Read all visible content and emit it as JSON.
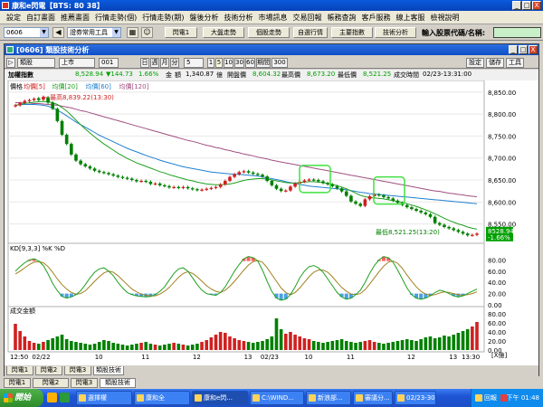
{
  "window": {
    "title": "康和e閃電【BTS: 80 38】",
    "buttons": [
      "_",
      "□",
      "X"
    ]
  },
  "menubar": [
    "設定",
    "自訂畫面",
    "推薦畫面",
    "行情走勢(個)",
    "行情走勢(期)",
    "盤後分析",
    "技術分析",
    "市場訊息",
    "交易回報",
    "帳務查詢",
    "客戶服務",
    "線上客服",
    "檢視說明"
  ],
  "toolbar": {
    "code_value": "0606",
    "combo_value": "證券常用工具",
    "buttons": [
      "閃電1",
      "大盤走勢",
      "個股走勢",
      "自選行情",
      "主要指數",
      "技術分析"
    ],
    "input_label": "輸入股票代碼/名稱:",
    "input_value": ""
  },
  "subwindow": {
    "title": "[0606] 類股技術分析",
    "buttons": [
      "_",
      "□",
      "X"
    ]
  },
  "charttools": {
    "category": "類股",
    "market": "上市",
    "code": "001",
    "periods": [
      "日",
      "週",
      "月",
      "分"
    ],
    "period_value": "5",
    "intervals": [
      "1",
      "5",
      "10",
      "30",
      "60"
    ],
    "interval_label": "期間",
    "interval_value": "300",
    "right_buttons": [
      "設定",
      "儲存",
      "工具"
    ]
  },
  "quote": {
    "name": "加權指數",
    "price": "8,528.94",
    "change": "▼144.73",
    "pct": "1.66%",
    "amount_label": "金",
    "amount_value": "額",
    "amount": "1,340.87",
    "amount_unit": "億",
    "open_label": "開盤價",
    "open": "8,604.32",
    "high_label": "最高價",
    "high": "8,673.20",
    "low_label": "最低價",
    "low": "8,521.25",
    "time_label": "成交時間",
    "time": "02/23-13:31:00"
  },
  "chart_data": {
    "type": "line",
    "title": "",
    "legend": [
      "價格",
      "均價[5]",
      "均價[20]",
      "均價[60]",
      "均價[120]"
    ],
    "price_axis": [
      "8,850.00",
      "8,800.00",
      "8,750.00",
      "8,700.00",
      "8,650.00",
      "8,600.00",
      "8,550.00"
    ],
    "ylim": [
      8510,
      8860
    ],
    "high_annotation": "最高8,839.22(13:30)",
    "low_annotation": "最低8,521.25(13:20)",
    "last_price_label": "8528.94",
    "last_pct_label": "-1.66%",
    "x_labels": [
      "12:50",
      "02/22",
      "10",
      "11",
      "12",
      "13",
      "02/23",
      "10",
      "11",
      "12",
      "13",
      "13:30"
    ],
    "close": [
      8820,
      8825,
      8830,
      8832,
      8835,
      8832,
      8839,
      8826,
      8812,
      8784,
      8753,
      8732,
      8708,
      8694,
      8686,
      8681,
      8676,
      8671,
      8668,
      8666,
      8663,
      8660,
      8657,
      8655,
      8653,
      8650,
      8647,
      8648,
      8646,
      8641,
      8642,
      8638,
      8636,
      8633,
      8634,
      8632,
      8634,
      8631,
      8629,
      8627,
      8628,
      8630,
      8632,
      8634,
      8640,
      8648,
      8657,
      8663,
      8668,
      8670,
      8667,
      8664,
      8662,
      8658,
      8648,
      8638,
      8630,
      8625,
      8626,
      8635,
      8642,
      8646,
      8649,
      8651,
      8650,
      8647,
      8643,
      8640,
      8636,
      8631,
      8624,
      8614,
      8601,
      8596,
      8591,
      8606,
      8613,
      8617,
      8615,
      8611,
      8608,
      8603,
      8598,
      8593,
      8588,
      8584,
      8580,
      8576,
      8572,
      8566,
      8552,
      8548,
      8543,
      8540,
      8536,
      8532,
      8528,
      8524,
      8525,
      8528
    ],
    "open": [
      8818,
      8820,
      8826,
      8830,
      8832,
      8836,
      8833,
      8838,
      8826,
      8812,
      8784,
      8753,
      8732,
      8708,
      8694,
      8686,
      8681,
      8676,
      8671,
      8668,
      8666,
      8663,
      8660,
      8657,
      8655,
      8653,
      8650,
      8647,
      8648,
      8646,
      8641,
      8642,
      8638,
      8636,
      8633,
      8634,
      8632,
      8634,
      8631,
      8629,
      8627,
      8628,
      8630,
      8632,
      8634,
      8640,
      8648,
      8657,
      8663,
      8668,
      8670,
      8667,
      8664,
      8662,
      8658,
      8648,
      8638,
      8630,
      8625,
      8626,
      8635,
      8642,
      8646,
      8649,
      8651,
      8650,
      8647,
      8643,
      8640,
      8636,
      8631,
      8624,
      8614,
      8601,
      8596,
      8591,
      8606,
      8613,
      8617,
      8615,
      8611,
      8608,
      8603,
      8598,
      8593,
      8588,
      8584,
      8580,
      8576,
      8572,
      8566,
      8552,
      8548,
      8543,
      8540,
      8536,
      8532,
      8528,
      8524,
      8525
    ],
    "ma20": [
      8820,
      8822,
      8824,
      8826,
      8827,
      8828,
      8829,
      8828,
      8826,
      8822,
      8815,
      8807,
      8797,
      8786,
      8776,
      8766,
      8757,
      8748,
      8740,
      8732,
      8725,
      8718,
      8711,
      8705,
      8699,
      8694,
      8689,
      8685,
      8681,
      8677,
      8673,
      8669,
      8666,
      8662,
      8659,
      8656,
      8653,
      8650,
      8648,
      8645,
      8643,
      8641,
      8640,
      8639,
      8639,
      8640,
      8641,
      8643,
      8646,
      8649,
      8651,
      8652,
      8653,
      8653,
      8652,
      8650,
      8648,
      8646,
      8644,
      8643,
      8643,
      8644,
      8645,
      8646,
      8646,
      8645,
      8644,
      8642,
      8640,
      8637,
      8634,
      8630,
      8625,
      8620,
      8615,
      8612,
      8610,
      8609,
      8608,
      8607,
      8605,
      8603,
      8601,
      8599,
      8596,
      8593,
      8590,
      8586,
      8582,
      8578,
      8573,
      8568,
      8563,
      8558,
      8554,
      8550,
      8547,
      8543,
      8540,
      8538
    ],
    "ma60": [
      8820,
      8821,
      8822,
      8822,
      8822,
      8821,
      8820,
      8818,
      8814,
      8809,
      8803,
      8796,
      8789,
      8782,
      8776,
      8770,
      8764,
      8758,
      8752,
      8747,
      8742,
      8737,
      8732,
      8727,
      8722,
      8718,
      8714,
      8710,
      8706,
      8702,
      8699,
      8695,
      8692,
      8689,
      8686,
      8683,
      8680,
      8678,
      8676,
      8674,
      8672,
      8670,
      8668,
      8667,
      8666,
      8665,
      8664,
      8663,
      8663,
      8662,
      8661,
      8660,
      8659,
      8657,
      8655,
      8653,
      8651,
      8649,
      8646,
      8644,
      8642,
      8640,
      8638,
      8636,
      8635,
      8634,
      8633,
      8632,
      8631,
      8630,
      8629,
      8628,
      8626,
      8624,
      8622,
      8621,
      8619,
      8618,
      8617,
      8616,
      8615,
      8614,
      8613,
      8612,
      8611,
      8610,
      8609,
      8608,
      8607,
      8606,
      8605,
      8604,
      8603,
      8602,
      8601,
      8600,
      8599,
      8598,
      8597,
      8596
    ],
    "ma120": [
      8826,
      8826,
      8825,
      8825,
      8824,
      8824,
      8823,
      8822,
      8821,
      8820,
      8818,
      8816,
      8814,
      8811,
      8808,
      8806,
      8803,
      8800,
      8797,
      8794,
      8791,
      8788,
      8785,
      8782,
      8779,
      8776,
      8773,
      8770,
      8767,
      8764,
      8761,
      8758,
      8755,
      8752,
      8749,
      8746,
      8743,
      8740,
      8738,
      8735,
      8732,
      8729,
      8727,
      8724,
      8722,
      8719,
      8717,
      8714,
      8712,
      8709,
      8707,
      8705,
      8702,
      8700,
      8698,
      8695,
      8693,
      8691,
      8689,
      8687,
      8685,
      8683,
      8681,
      8679,
      8677,
      8675,
      8673,
      8671,
      8669,
      8667,
      8665,
      8663,
      8661,
      8659,
      8657,
      8655,
      8653,
      8651,
      8649,
      8647,
      8645,
      8643,
      8641,
      8639,
      8637,
      8635,
      8633,
      8631,
      8629,
      8627,
      8625,
      8624,
      8622,
      8620,
      8619,
      8617,
      8616,
      8614,
      8613,
      8612
    ],
    "kd_label": "KD[9,3,3] %K %D",
    "kd_axis": [
      "80.00",
      "60.00",
      "40.00",
      "20.00",
      "0.00"
    ],
    "k": [
      60,
      68,
      75,
      80,
      82,
      78,
      70,
      55,
      38,
      25,
      15,
      12,
      14,
      18,
      25,
      36,
      48,
      58,
      64,
      66,
      60,
      52,
      40,
      30,
      22,
      18,
      16,
      15,
      14,
      15,
      18,
      24,
      32,
      44,
      56,
      64,
      66,
      60,
      48,
      36,
      26,
      20,
      18,
      17,
      22,
      32,
      46,
      60,
      72,
      82,
      86,
      84,
      78,
      62,
      42,
      24,
      12,
      8,
      10,
      18,
      32,
      48,
      60,
      68,
      70,
      66,
      58,
      46,
      34,
      22,
      14,
      10,
      12,
      18,
      26,
      40,
      56,
      70,
      80,
      86,
      84,
      76,
      62,
      46,
      30,
      18,
      12,
      10,
      12,
      16,
      22,
      26,
      24,
      20,
      16,
      14,
      16,
      20,
      24,
      28
    ],
    "d": [
      55,
      60,
      66,
      72,
      76,
      77,
      75,
      68,
      58,
      46,
      36,
      28,
      22,
      19,
      20,
      25,
      33,
      42,
      50,
      57,
      60,
      58,
      52,
      44,
      36,
      28,
      23,
      19,
      17,
      16,
      16,
      19,
      24,
      31,
      40,
      49,
      56,
      59,
      56,
      50,
      42,
      34,
      28,
      24,
      22,
      26,
      33,
      42,
      52,
      62,
      71,
      77,
      79,
      76,
      66,
      54,
      42,
      30,
      22,
      18,
      22,
      30,
      40,
      50,
      58,
      62,
      62,
      58,
      50,
      40,
      31,
      24,
      19,
      18,
      20,
      27,
      37,
      48,
      59,
      69,
      76,
      78,
      74,
      65,
      53,
      42,
      32,
      24,
      19,
      17,
      18,
      21,
      23,
      22,
      20,
      18,
      17,
      18,
      20,
      23
    ],
    "vol_label": "成交金額",
    "vol_axis": [
      "80.00",
      "60.00",
      "40.00",
      "20.00",
      "0.00"
    ],
    "vol_unit": "[X億]",
    "volume": [
      58,
      42,
      30,
      20,
      16,
      14,
      18,
      22,
      26,
      30,
      34,
      24,
      20,
      18,
      16,
      14,
      12,
      14,
      18,
      22,
      20,
      16,
      14,
      12,
      10,
      12,
      14,
      16,
      18,
      14,
      12,
      10,
      12,
      14,
      16,
      14,
      12,
      10,
      12,
      14,
      18,
      22,
      28,
      34,
      40,
      38,
      30,
      26,
      22,
      20,
      18,
      16,
      18,
      20,
      24,
      30,
      70,
      46,
      36,
      40,
      34,
      30,
      26,
      24,
      20,
      18,
      16,
      18,
      20,
      22,
      24,
      20,
      18,
      16,
      18,
      20,
      22,
      18,
      16,
      14,
      16,
      18,
      20,
      22,
      24,
      22,
      20,
      24,
      28,
      30,
      26,
      28,
      32,
      30,
      34,
      38,
      42,
      46,
      52,
      62
    ]
  },
  "chart_tabs": [
    "閃電1",
    "閃電2",
    "閃電3",
    "類股技術"
  ],
  "bottom_tabs": [
    "閃電1",
    "閃電2",
    "閃電3",
    "類股技術"
  ],
  "taskbar": {
    "start_label": "開始",
    "tasks": [
      "選擇權",
      "康和全",
      "康和e閃...",
      "C:\\WIND...",
      "新浪部...",
      "審議分...",
      "02/23-30"
    ],
    "tray_text": "回報",
    "clock": "下午 01:48"
  }
}
